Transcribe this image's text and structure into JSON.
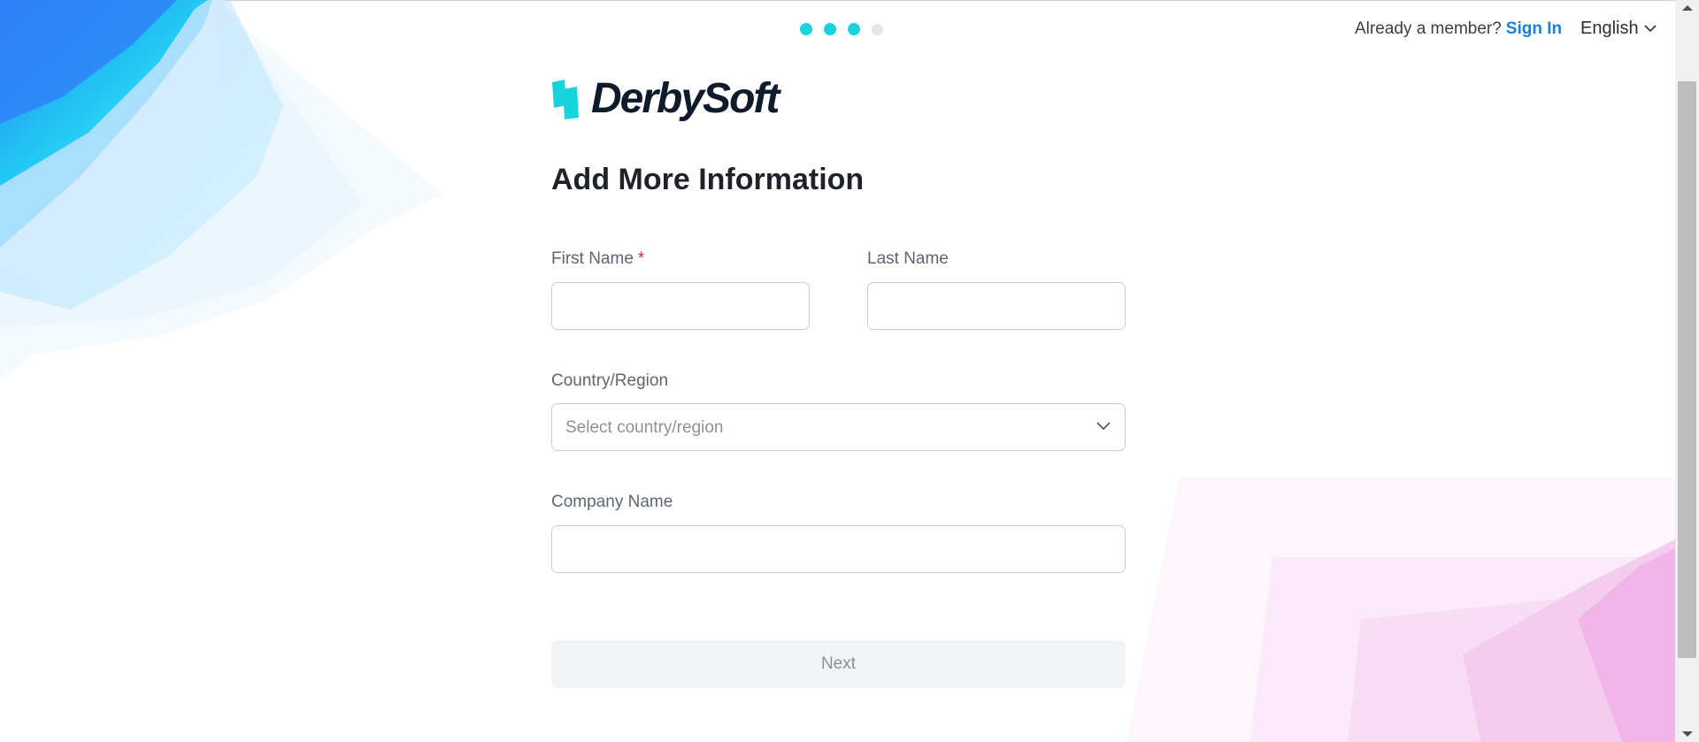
{
  "steps": {
    "total": 4,
    "completed": 3
  },
  "header": {
    "member_prompt": "Already a member?",
    "sign_in_label": "Sign In",
    "language": "English"
  },
  "logo": {
    "text": "DerbySoft",
    "brand_color": "#19d3dc"
  },
  "form": {
    "title": "Add More Information",
    "first_name": {
      "label": "First Name",
      "required_mark": "*",
      "value": ""
    },
    "last_name": {
      "label": "Last Name",
      "value": ""
    },
    "country": {
      "label": "Country/Region",
      "placeholder": "Select country/region"
    },
    "company": {
      "label": "Company Name",
      "value": ""
    },
    "next_label": "Next"
  },
  "colors": {
    "accent": "#19d3dc",
    "link": "#1c7fd6",
    "required": "#e0333a",
    "disabled_button_bg": "#f3f4f5"
  }
}
